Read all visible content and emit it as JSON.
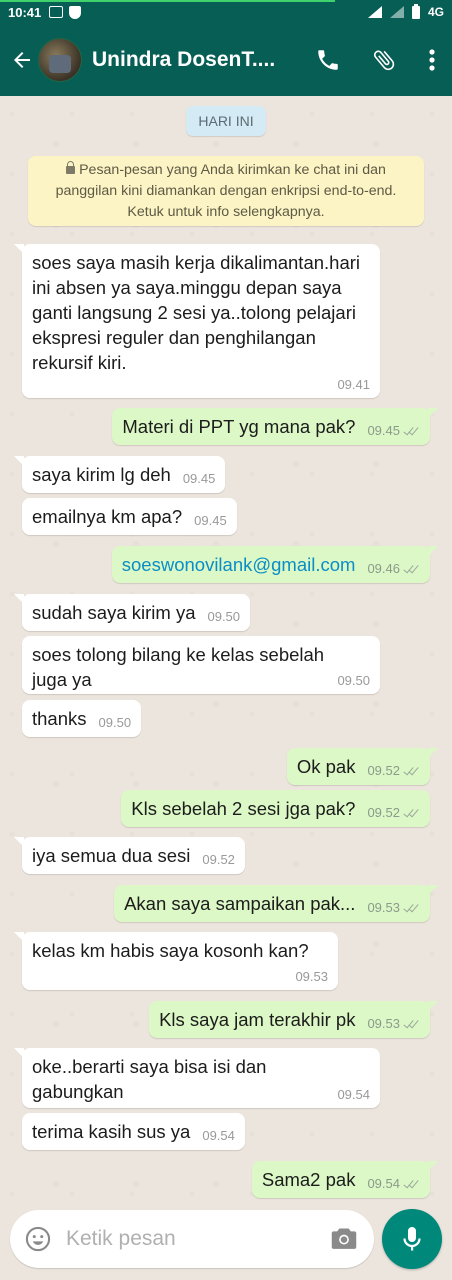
{
  "status_bar": {
    "time": "10:41",
    "network": "4G"
  },
  "header": {
    "title": "Unindra DosenT...."
  },
  "chat": {
    "date_chip": "HARI INI",
    "encryption_notice": "Pesan-pesan yang Anda kirimkan ke chat ini dan panggilan kini diamankan dengan enkripsi end-to-end. Ketuk untuk info selengkapnya.",
    "messages": [
      {
        "dir": "in",
        "text": "soes saya masih kerja dikalimantan.hari ini absen ya saya.minggu depan saya ganti langsung 2 sesi ya..tolong pelajari ekspresi reguler dan penghilangan rekursif kiri.",
        "time": "09.41"
      },
      {
        "dir": "out",
        "text": "Materi di PPT yg mana pak?",
        "time": "09.45"
      },
      {
        "dir": "in",
        "text": "saya kirim lg deh",
        "time": "09.45"
      },
      {
        "dir": "in",
        "text": "emailnya km apa?",
        "time": "09.45"
      },
      {
        "dir": "out",
        "text": "soeswonovilank@gmail.com",
        "time": "09.46"
      },
      {
        "dir": "in",
        "text": "sudah saya kirim ya",
        "time": "09.50"
      },
      {
        "dir": "in",
        "text": "soes tolong bilang ke kelas sebelah juga ya",
        "time": "09.50"
      },
      {
        "dir": "in",
        "text": "thanks",
        "time": "09.50"
      },
      {
        "dir": "out",
        "text": "Ok pak",
        "time": "09.52"
      },
      {
        "dir": "out",
        "text": "Kls sebelah 2 sesi jga pak?",
        "time": "09.52"
      },
      {
        "dir": "in",
        "text": "iya semua dua sesi",
        "time": "09.52"
      },
      {
        "dir": "out",
        "text": "Akan saya sampaikan pak...",
        "time": "09.53"
      },
      {
        "dir": "in",
        "text": "kelas km habis saya kosonh kan?",
        "time": "09.53"
      },
      {
        "dir": "out",
        "text": "Kls saya jam terakhir pk",
        "time": "09.53"
      },
      {
        "dir": "in",
        "text": "oke..berarti saya bisa isi dan gabungkan",
        "time": "09.54"
      },
      {
        "dir": "in",
        "text": "terima kasih sus ya",
        "time": "09.54"
      },
      {
        "dir": "out",
        "text": "Sama2 pak",
        "time": "09.54"
      }
    ]
  },
  "composer": {
    "placeholder": "Ketik pesan"
  },
  "colors": {
    "header": "#075E54",
    "outgoing_bubble": "#DCF8C6",
    "mic_button": "#00897B",
    "link": "#0a8ec7"
  }
}
